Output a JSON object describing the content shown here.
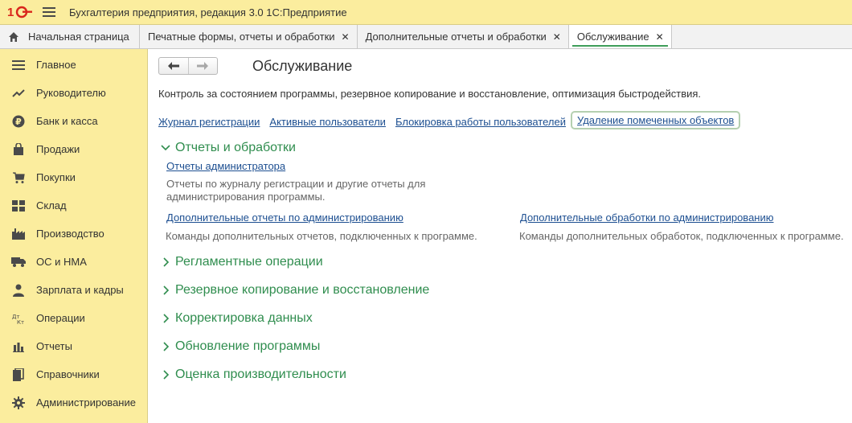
{
  "window": {
    "title": "Бухгалтерия предприятия, редакция 3.0 1С:Предприятие"
  },
  "tabs": {
    "home": "Начальная страница",
    "items": [
      {
        "label": "Печатные формы, отчеты и обработки"
      },
      {
        "label": "Дополнительные отчеты и обработки"
      },
      {
        "label": "Обслуживание"
      }
    ]
  },
  "sidebar": {
    "items": [
      {
        "label": "Главное",
        "icon": "menu-lines-icon"
      },
      {
        "label": "Руководителю",
        "icon": "trend-icon"
      },
      {
        "label": "Банк и касса",
        "icon": "ruble-icon"
      },
      {
        "label": "Продажи",
        "icon": "bag-icon"
      },
      {
        "label": "Покупки",
        "icon": "cart-icon"
      },
      {
        "label": "Склад",
        "icon": "warehouse-icon"
      },
      {
        "label": "Производство",
        "icon": "factory-icon"
      },
      {
        "label": "ОС и НМА",
        "icon": "truck-icon"
      },
      {
        "label": "Зарплата и кадры",
        "icon": "person-icon"
      },
      {
        "label": "Операции",
        "icon": "dt-kt-icon"
      },
      {
        "label": "Отчеты",
        "icon": "bar-chart-icon"
      },
      {
        "label": "Справочники",
        "icon": "books-icon"
      },
      {
        "label": "Администрирование",
        "icon": "gear-icon"
      }
    ]
  },
  "main": {
    "title": "Обслуживание",
    "description": "Контроль за состоянием программы, резервное копирование и восстановление, оптимизация быстродействия.",
    "top_links": [
      "Журнал регистрации",
      "Активные пользователи",
      "Блокировка работы пользователей",
      "Удаление помеченных объектов"
    ],
    "sections": [
      {
        "title": "Отчеты и обработки",
        "expanded": true,
        "items": [
          {
            "link": "Отчеты администратора",
            "desc": "Отчеты по журналу регистрации и другие отчеты для администрирования программы."
          },
          {
            "link": "Дополнительные отчеты по администрированию",
            "desc": "Команды дополнительных отчетов, подключенных к программе."
          },
          {
            "link": "Дополнительные обработки по администрированию",
            "desc": "Команды дополнительных обработок, подключенных к программе."
          }
        ]
      },
      {
        "title": "Регламентные операции",
        "expanded": false
      },
      {
        "title": "Резервное копирование и восстановление",
        "expanded": false
      },
      {
        "title": "Корректировка данных",
        "expanded": false
      },
      {
        "title": "Обновление программы",
        "expanded": false
      },
      {
        "title": "Оценка производительности",
        "expanded": false
      }
    ]
  },
  "colors": {
    "accent_green": "#2f8d4e",
    "link_blue": "#1d4f91",
    "sidebar_bg": "#fbed9e"
  }
}
